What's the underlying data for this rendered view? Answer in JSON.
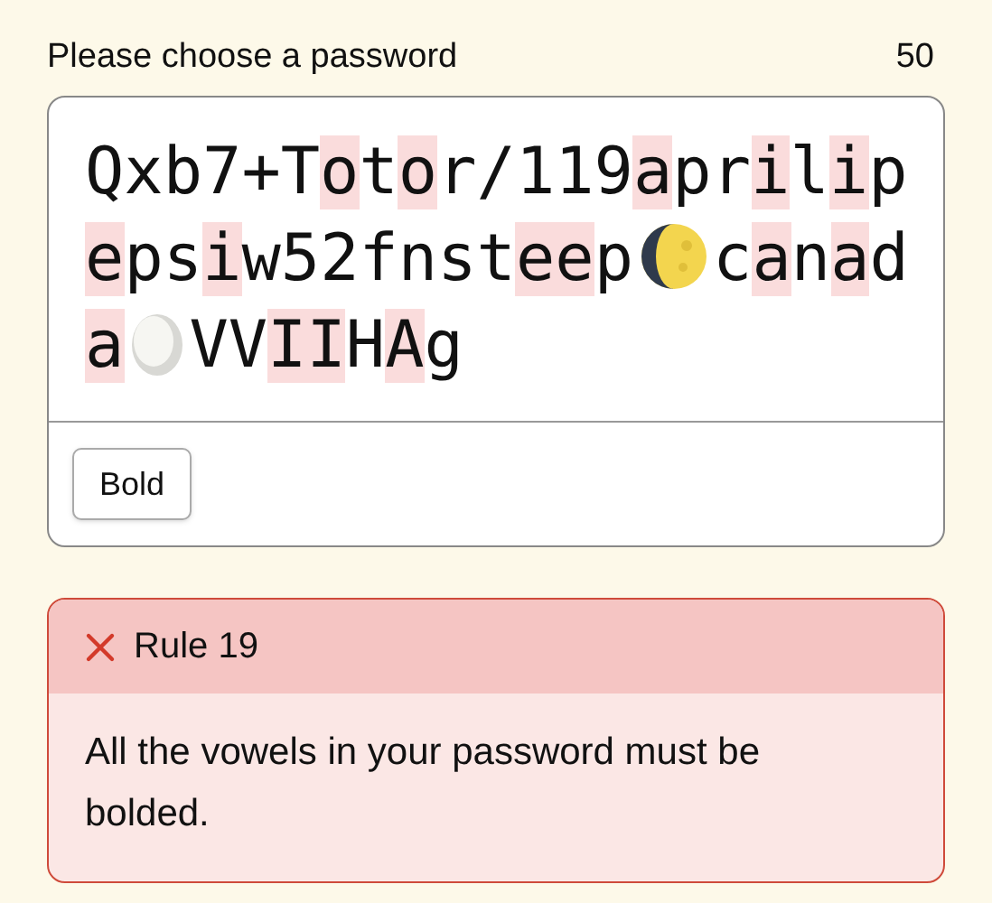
{
  "header": {
    "label": "Please choose a password",
    "count": "50"
  },
  "password": {
    "segments": [
      {
        "kind": "text",
        "text": "Qxb7+T",
        "highlighted": false
      },
      {
        "kind": "text",
        "text": "o",
        "highlighted": true
      },
      {
        "kind": "text",
        "text": "t",
        "highlighted": false
      },
      {
        "kind": "text",
        "text": "o",
        "highlighted": true
      },
      {
        "kind": "text",
        "text": "r/119",
        "highlighted": false
      },
      {
        "kind": "text",
        "text": "a",
        "highlighted": true
      },
      {
        "kind": "text",
        "text": "pr",
        "highlighted": false
      },
      {
        "kind": "text",
        "text": "i",
        "highlighted": true
      },
      {
        "kind": "text",
        "text": "l",
        "highlighted": false
      },
      {
        "kind": "text",
        "text": "i",
        "highlighted": true
      },
      {
        "kind": "text",
        "text": "p",
        "highlighted": false
      },
      {
        "kind": "text",
        "text": "e",
        "highlighted": true
      },
      {
        "kind": "text",
        "text": "ps",
        "highlighted": false
      },
      {
        "kind": "text",
        "text": "i",
        "highlighted": true
      },
      {
        "kind": "text",
        "text": "w52fnst",
        "highlighted": false
      },
      {
        "kind": "text",
        "text": "ee",
        "highlighted": true
      },
      {
        "kind": "text",
        "text": "p",
        "highlighted": false
      },
      {
        "kind": "moon"
      },
      {
        "kind": "text",
        "text": "c",
        "highlighted": false
      },
      {
        "kind": "text",
        "text": "a",
        "highlighted": true
      },
      {
        "kind": "text",
        "text": "n",
        "highlighted": false
      },
      {
        "kind": "text",
        "text": "a",
        "highlighted": true
      },
      {
        "kind": "text",
        "text": "d",
        "highlighted": false
      },
      {
        "kind": "text",
        "text": "a",
        "highlighted": true
      },
      {
        "kind": "egg"
      },
      {
        "kind": "text",
        "text": "VV",
        "highlighted": false
      },
      {
        "kind": "text",
        "text": "II",
        "highlighted": true
      },
      {
        "kind": "text",
        "text": "H",
        "highlighted": false
      },
      {
        "kind": "text",
        "text": "A",
        "highlighted": true
      },
      {
        "kind": "text",
        "text": "g",
        "highlighted": false
      }
    ]
  },
  "toolbar": {
    "buttons": [
      {
        "label": "Bold"
      }
    ]
  },
  "rules": [
    {
      "title": "Rule 19",
      "failed": true,
      "message": "All the vowels in your password must be bolded."
    }
  ]
}
